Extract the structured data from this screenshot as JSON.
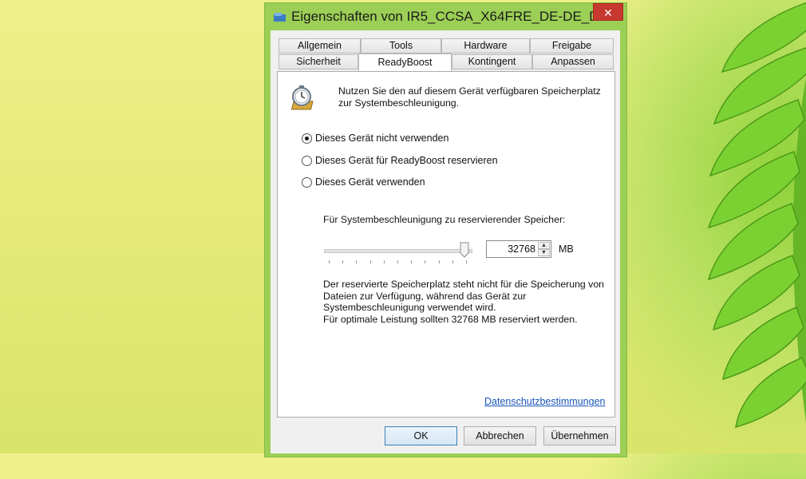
{
  "window": {
    "title": "Eigenschaften von IR5_CCSA_X64FRE_DE-DE_D...",
    "close_label": "✕"
  },
  "tabs": {
    "row1": [
      "Allgemein",
      "Tools",
      "Hardware",
      "Freigabe"
    ],
    "row2": [
      "Sicherheit",
      "ReadyBoost",
      "Kontingent",
      "Anpassen"
    ],
    "active": "ReadyBoost"
  },
  "readyboost": {
    "intro": "Nutzen Sie den auf diesem Gerät verfügbaren Speicherplatz zur Systembeschleunigung.",
    "options": [
      {
        "label": "Dieses Gerät nicht verwenden",
        "checked": true
      },
      {
        "label": "Dieses Gerät für ReadyBoost reservieren",
        "checked": false
      },
      {
        "label": "Dieses Gerät verwenden",
        "checked": false
      }
    ],
    "reserve_label": "Für Systembeschleunigung zu reservierender Speicher:",
    "slider_fraction": 1.0,
    "value": "32768",
    "unit": "MB",
    "info_text": "Der reservierte Speicherplatz steht nicht für die Speicherung von Dateien zur Verfügung, während das Gerät zur Systembeschleunigung verwendet wird.",
    "recommendation": "Für optimale Leistung sollten 32768 MB reserviert werden.",
    "privacy_link": "Datenschutzbestimmungen"
  },
  "buttons": {
    "ok": "OK",
    "cancel": "Abbrechen",
    "apply": "Übernehmen"
  },
  "icons": {
    "app": "drive-icon",
    "readyboost": "stopwatch-icon"
  },
  "colors": {
    "frame": "#9ccf55",
    "close": "#c7382f",
    "link": "#1a56b8"
  }
}
